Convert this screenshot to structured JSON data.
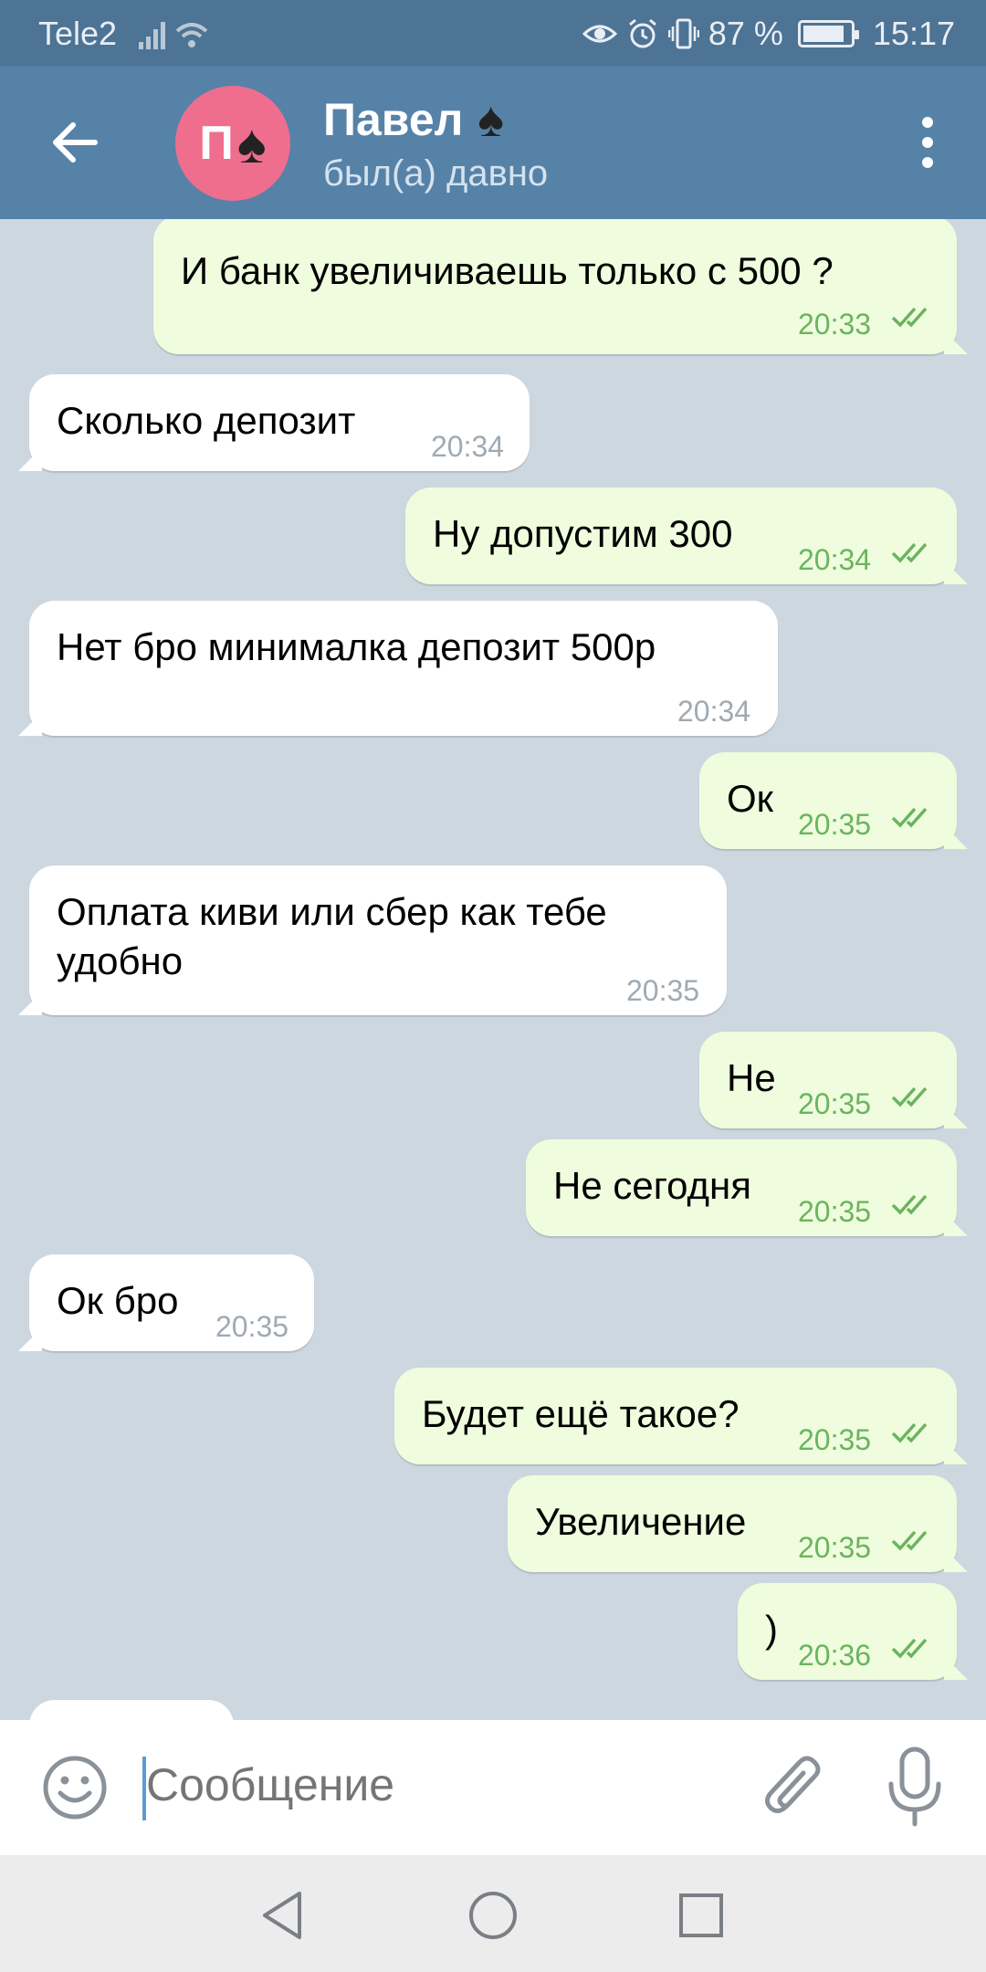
{
  "status_bar": {
    "carrier": "Tele2",
    "battery": "87 %",
    "time": "15:17",
    "battery_level": 0.87
  },
  "header": {
    "title": "Павел",
    "avatar_letter": "П",
    "subtitle": "был(а) давно"
  },
  "messages": [
    {
      "text": "И банк увеличиваешь только с 500 ?",
      "time": "20:33",
      "direction": "out"
    },
    {
      "text": "Сколько депозит",
      "time": "20:34",
      "direction": "in"
    },
    {
      "text": "Ну допустим 300",
      "time": "20:34",
      "direction": "out"
    },
    {
      "text": "Нет бро минималка депозит 500р",
      "time": "20:34",
      "direction": "in"
    },
    {
      "text": "Ок",
      "time": "20:35",
      "direction": "out"
    },
    {
      "text_line1": "Оплата киви или сбер как тебе",
      "text_line2": "удобно",
      "time": "20:35",
      "direction": "in"
    },
    {
      "text": "Не",
      "time": "20:35",
      "direction": "out"
    },
    {
      "text": "Не сегодня",
      "time": "20:35",
      "direction": "out"
    },
    {
      "text": "Ок бро",
      "time": "20:35",
      "direction": "in"
    },
    {
      "text": "Будет ещё такое?",
      "time": "20:35",
      "direction": "out"
    },
    {
      "text": "Увеличение",
      "time": "20:35",
      "direction": "out"
    },
    {
      "text": ")",
      "time": "20:36",
      "direction": "out"
    }
  ],
  "input": {
    "placeholder": "Сообщение"
  },
  "icons": {
    "back": "arrow-left-icon",
    "more": "more-vertical-icon",
    "emoji": "emoji-icon",
    "attach": "paperclip-icon",
    "mic": "microphone-icon",
    "read": "double-check-icon",
    "nav_back": "triangle-back-icon",
    "nav_home": "circle-home-icon",
    "nav_recent": "square-recent-icon"
  },
  "colors": {
    "header": "#5682a8",
    "status_bar": "#4d7395",
    "outgoing_bubble": "#effdde",
    "incoming_bubble": "#ffffff",
    "chat_bg": "#cdd7e0",
    "read_check": "#6bb45e",
    "avatar": "#ef6e8d"
  }
}
